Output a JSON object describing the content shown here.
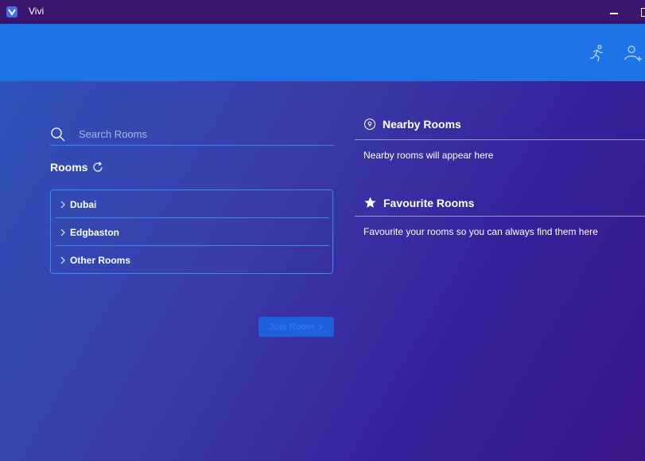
{
  "window": {
    "title": "Vivi"
  },
  "search": {
    "placeholder": "Search Rooms",
    "value": ""
  },
  "rooms": {
    "title": "Rooms",
    "items": [
      {
        "label": "Dubai"
      },
      {
        "label": "Edgbaston"
      },
      {
        "label": "Other Rooms"
      }
    ]
  },
  "join_button": {
    "label": "Join Room"
  },
  "nearby": {
    "title": "Nearby Rooms",
    "message": "Nearby rooms will appear here"
  },
  "favourites": {
    "title": "Favourite Rooms",
    "message": "Favourite your rooms so you can always find them here"
  },
  "colors": {
    "titlebar": "#3a1670",
    "header": "#1e74e6",
    "accent": "#3a8cf0",
    "button": "#1f5fe0"
  },
  "icons": {
    "app": "vivi-logo-icon",
    "header_left": "running-person-icon",
    "header_right": "add-user-icon",
    "search": "search-icon",
    "refresh": "refresh-icon",
    "nearby": "location-pin-icon",
    "favourites": "star-icon",
    "room_item": "chevron-right-icon",
    "join": "chevron-right-icon"
  }
}
